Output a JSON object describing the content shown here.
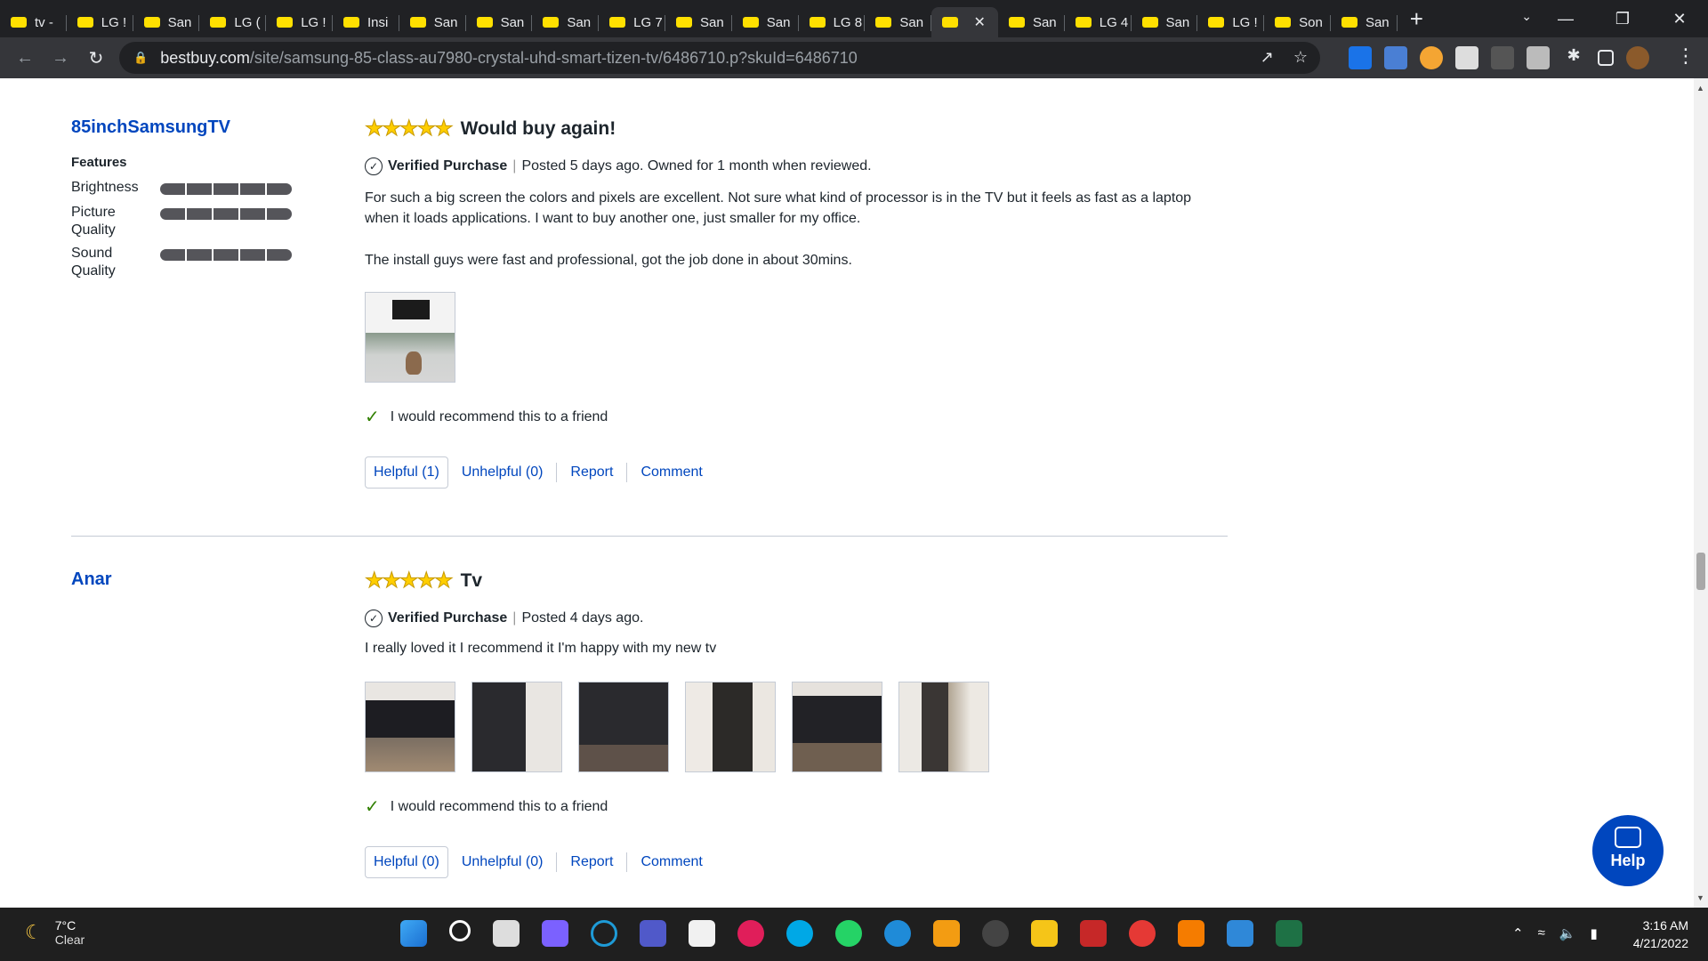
{
  "browser": {
    "tabs": [
      {
        "label": "tv -"
      },
      {
        "label": "LG !"
      },
      {
        "label": "San"
      },
      {
        "label": "LG ("
      },
      {
        "label": "LG !"
      },
      {
        "label": "Insi"
      },
      {
        "label": "San"
      },
      {
        "label": "San"
      },
      {
        "label": "San"
      },
      {
        "label": "LG 7"
      },
      {
        "label": "San"
      },
      {
        "label": "San"
      },
      {
        "label": "LG 8"
      },
      {
        "label": "San"
      },
      {
        "label": ""
      },
      {
        "label": "San"
      },
      {
        "label": "LG 4"
      },
      {
        "label": "San"
      },
      {
        "label": "LG !"
      },
      {
        "label": "Son"
      },
      {
        "label": "San"
      }
    ],
    "active_tab_index": 14,
    "url_host": "bestbuy.com",
    "url_path": "/site/samsung-85-class-au7980-crystal-uhd-smart-tizen-tv/6486710.p?skuId=6486710"
  },
  "reviews": [
    {
      "author": "85inchSamsungTV",
      "features_heading": "Features",
      "features": [
        {
          "label": "Brightness",
          "rating": 5
        },
        {
          "label": "Picture Quality",
          "rating": 5
        },
        {
          "label": "Sound Quality",
          "rating": 5
        }
      ],
      "stars": "★★★★★",
      "rating": 5,
      "title": "Would buy again!",
      "verified": "Verified Purchase",
      "posted": "Posted 5 days ago. Owned for 1 month when reviewed.",
      "text1": "For such a big screen the colors and pixels are excellent. Not sure what kind of processor is in the TV but it feels as fast as a laptop when it loads applications. I want to buy another one, just smaller for my office.",
      "text2": "The install guys were fast and professional, got the job done in about 30mins.",
      "recommend": "I would recommend this to a friend",
      "helpful": "Helpful (1)",
      "unhelpful": "Unhelpful (0)",
      "report": "Report",
      "comment": "Comment"
    },
    {
      "author": "Anar",
      "stars": "★★★★★",
      "rating": 5,
      "title": "Tv",
      "verified": "Verified Purchase",
      "posted": "Posted 4 days ago.",
      "text1": "I really loved it I recommend it I'm happy with my new tv",
      "recommend": "I would recommend this to a friend",
      "helpful": "Helpful (0)",
      "unhelpful": "Unhelpful (0)",
      "report": "Report",
      "comment": "Comment"
    }
  ],
  "help": {
    "label": "Help"
  },
  "taskbar": {
    "weather_temp": "7°C",
    "weather_desc": "Clear",
    "time": "3:16 AM",
    "date": "4/21/2022"
  },
  "colors": {
    "link_blue": "#0046be",
    "star_yellow": "#ffce00",
    "tab_favicon": "#ffe000"
  }
}
